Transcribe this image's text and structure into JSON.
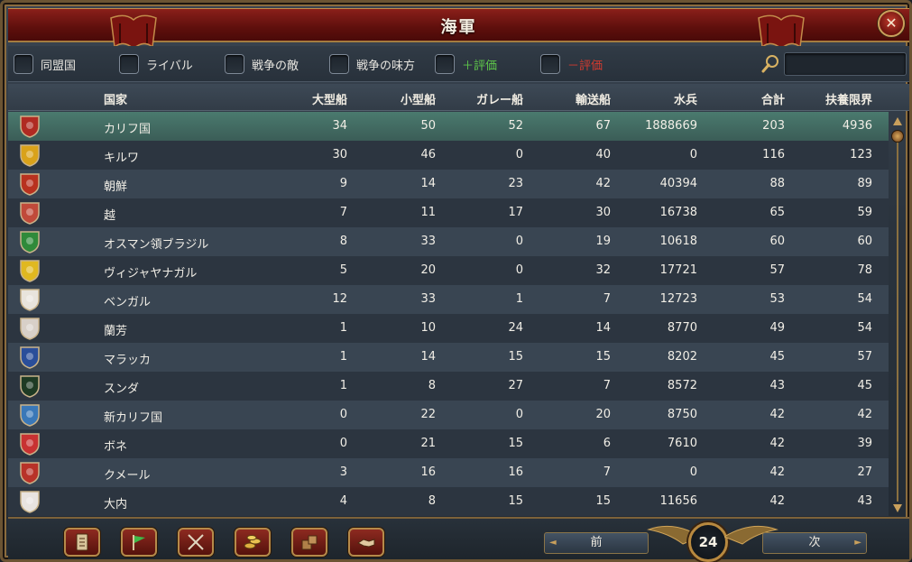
{
  "window": {
    "title": "海軍"
  },
  "filters": [
    {
      "label": "同盟国",
      "style": "normal"
    },
    {
      "label": "ライバル",
      "style": "normal"
    },
    {
      "label": "戦争の敵",
      "style": "normal"
    },
    {
      "label": "戦争の味方",
      "style": "normal"
    },
    {
      "label": "＋評価",
      "style": "plus"
    },
    {
      "label": "－評価",
      "style": "minus"
    }
  ],
  "search": {
    "value": ""
  },
  "table": {
    "headers": [
      "国家",
      "大型船",
      "小型船",
      "ガレー船",
      "輸送船",
      "水兵",
      "合計",
      "扶養限界"
    ],
    "rows": [
      {
        "nation": "カリフ国",
        "heavy": "34",
        "light": "50",
        "galley": "52",
        "transport": "67",
        "sailors": "1888669",
        "total": "203",
        "limit": "4936",
        "shield_color": "#b02a22",
        "shield_icon": "crescent-shield-icon"
      },
      {
        "nation": "キルワ",
        "heavy": "30",
        "light": "46",
        "galley": "0",
        "transport": "40",
        "sailors": "0",
        "total": "116",
        "limit": "123",
        "shield_color": "#d9a21a",
        "shield_icon": "red-gold-shield-icon"
      },
      {
        "nation": "朝鮮",
        "heavy": "9",
        "light": "14",
        "galley": "23",
        "transport": "42",
        "sailors": "40394",
        "total": "88",
        "limit": "89",
        "shield_color": "#b8321f",
        "shield_icon": "sun-shield-icon"
      },
      {
        "nation": "越",
        "heavy": "7",
        "light": "11",
        "galley": "17",
        "transport": "30",
        "sailors": "16738",
        "total": "65",
        "limit": "59",
        "shield_color": "#c04a3a",
        "shield_icon": "dragon-shield-icon"
      },
      {
        "nation": "オスマン領ブラジル",
        "heavy": "8",
        "light": "33",
        "galley": "0",
        "transport": "19",
        "sailors": "10618",
        "total": "60",
        "limit": "60",
        "shield_color": "#2f8a3a",
        "shield_icon": "crescent-shield-icon"
      },
      {
        "nation": "ヴィジャヤナガル",
        "heavy": "5",
        "light": "20",
        "galley": "0",
        "transport": "32",
        "sailors": "17721",
        "total": "57",
        "limit": "78",
        "shield_color": "#e0b820",
        "shield_icon": "bird-shield-icon"
      },
      {
        "nation": "ベンガル",
        "heavy": "12",
        "light": "33",
        "galley": "1",
        "transport": "7",
        "sailors": "12723",
        "total": "53",
        "limit": "54",
        "shield_color": "#e8e4dc",
        "shield_icon": "flower-shield-icon"
      },
      {
        "nation": "蘭芳",
        "heavy": "1",
        "light": "10",
        "galley": "24",
        "transport": "14",
        "sailors": "8770",
        "total": "49",
        "limit": "54",
        "shield_color": "#d8d0c8",
        "shield_icon": "glyph-shield-icon"
      },
      {
        "nation": "マラッカ",
        "heavy": "1",
        "light": "14",
        "galley": "15",
        "transport": "15",
        "sailors": "8202",
        "total": "45",
        "limit": "57",
        "shield_color": "#2a4e9a",
        "shield_icon": "star-shield-icon"
      },
      {
        "nation": "スンダ",
        "heavy": "1",
        "light": "8",
        "galley": "27",
        "transport": "7",
        "sailors": "8572",
        "total": "43",
        "limit": "45",
        "shield_color": "#1e3a24",
        "shield_icon": "dagger-shield-icon"
      },
      {
        "nation": "新カリフ国",
        "heavy": "0",
        "light": "22",
        "galley": "0",
        "transport": "20",
        "sailors": "8750",
        "total": "42",
        "limit": "42",
        "shield_color": "#3a78b8",
        "shield_icon": "crescent-shield-icon"
      },
      {
        "nation": "ボネ",
        "heavy": "0",
        "light": "21",
        "galley": "15",
        "transport": "6",
        "sailors": "7610",
        "total": "42",
        "limit": "39",
        "shield_color": "#c83232",
        "shield_icon": "stripes-shield-icon"
      },
      {
        "nation": "クメール",
        "heavy": "3",
        "light": "16",
        "galley": "16",
        "transport": "7",
        "sailors": "0",
        "total": "42",
        "limit": "27",
        "shield_color": "#b83228",
        "shield_icon": "temple-shield-icon"
      },
      {
        "nation": "大内",
        "heavy": "4",
        "light": "8",
        "galley": "15",
        "transport": "15",
        "sailors": "11656",
        "total": "42",
        "limit": "43",
        "shield_color": "#e8e4e0",
        "shield_icon": "mon-shield-icon"
      }
    ]
  },
  "footer": {
    "tools": [
      "ledger-icon",
      "flag-icon",
      "crossed-swords-icon",
      "coins-icon",
      "crates-icon",
      "handshake-icon"
    ],
    "prev_label": "前",
    "next_label": "次",
    "page": "24"
  }
}
